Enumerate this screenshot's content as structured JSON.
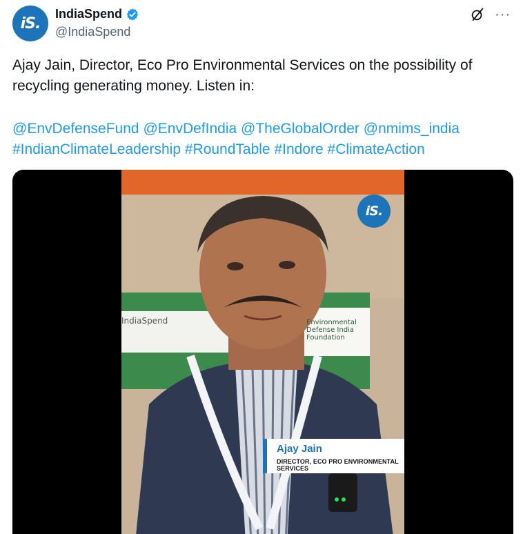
{
  "account": {
    "display_name": "IndiaSpend",
    "handle": "@IndiaSpend",
    "avatar_text": "iS.",
    "verified": true
  },
  "actions": {
    "grok_icon": "grok-slash-icon",
    "more_label": "···"
  },
  "tweet": {
    "text": "Ajay Jain, Director, Eco Pro Environmental Services on the possibility of recycling generating money. Listen in:",
    "mentions": [
      "@EnvDefenseFund",
      "@EnvDefIndia",
      "@TheGlobalOrder",
      "@nmims_india"
    ],
    "hashtags": [
      "#IndianClimateLeadership",
      "#RoundTable",
      "#Indore",
      "#ClimateAction"
    ]
  },
  "video": {
    "logo_text": "iS.",
    "lower_third_name": "Ajay Jain",
    "lower_third_title": "DIRECTOR, ECO PRO ENVIRONMENTAL SERVICES",
    "banner_left_text": "IndiaSpend",
    "banner_right_line1": "Environmental",
    "banner_right_line2": "Defense India",
    "banner_right_line3": "Foundation"
  },
  "colors": {
    "brand_blue": "#1d74b9",
    "link_blue": "#1d9bf0",
    "handle_gray": "#536471"
  }
}
